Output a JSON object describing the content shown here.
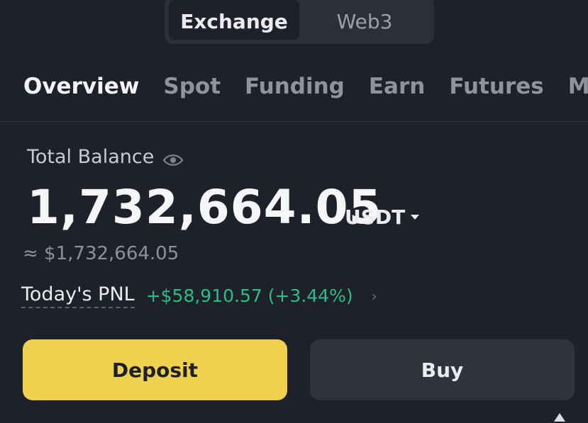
{
  "switch": {
    "tabs": [
      {
        "label": "Exchange"
      },
      {
        "label": "Web3"
      }
    ]
  },
  "subnav": [
    {
      "label": "Overview"
    },
    {
      "label": "Spot"
    },
    {
      "label": "Funding"
    },
    {
      "label": "Earn"
    },
    {
      "label": "Futures"
    },
    {
      "label": "Margi"
    }
  ],
  "balance": {
    "label": "Total Balance",
    "amount": "1,732,664.05",
    "currency": "USDT",
    "approx": "≈ $1,732,664.05"
  },
  "pnl": {
    "label": "Today's PNL",
    "value": "+$58,910.57 (+3.44%)",
    "chevron": "›"
  },
  "actions": {
    "deposit_label": "Deposit",
    "buy_label": "Buy"
  },
  "colors": {
    "accent": "#f0d04f",
    "positive": "#2ebd85",
    "background": "#1e2129"
  }
}
